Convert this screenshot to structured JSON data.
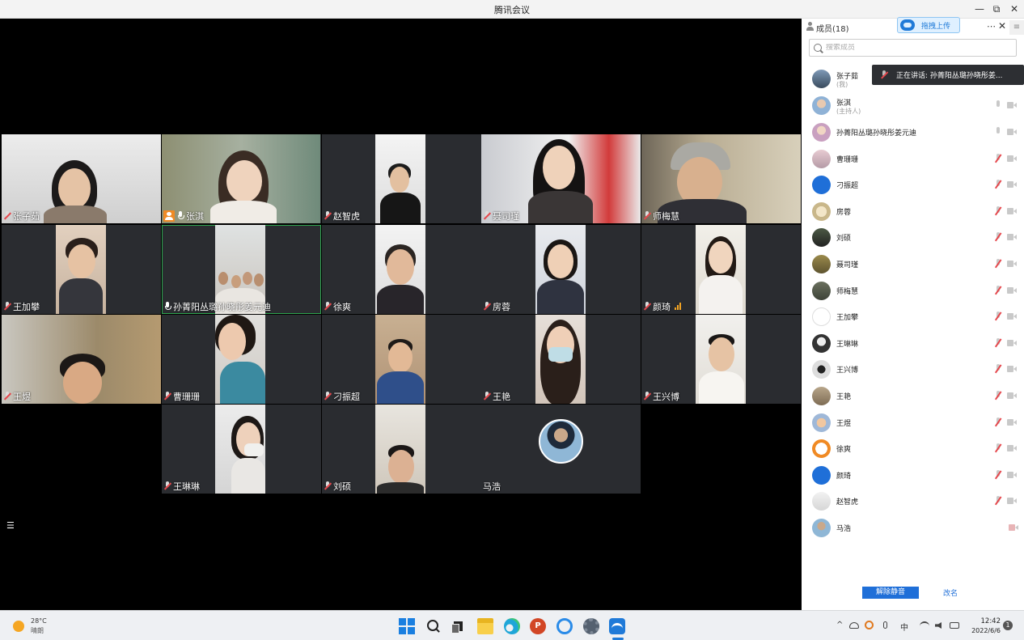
{
  "window": {
    "title": "腾讯会议",
    "minimize_label": "—",
    "restore_label": "⧉",
    "close_label": "✕"
  },
  "tiles": [
    {
      "name": "张子茹"
    },
    {
      "name": "张淇"
    },
    {
      "name": "赵智虎"
    },
    {
      "name": "聂司瑾"
    },
    {
      "name": "师梅慧"
    },
    {
      "name": "王加攀"
    },
    {
      "name": "孙菁阳丛璐孙晓彤姜元迪"
    },
    {
      "name": "徐爽"
    },
    {
      "name": "房蓉"
    },
    {
      "name": "颜琦"
    },
    {
      "name": "王煜"
    },
    {
      "name": "曹珊珊"
    },
    {
      "name": "刁振超"
    },
    {
      "name": "王艳"
    },
    {
      "name": "王兴博"
    },
    {
      "name": "王琳琳"
    },
    {
      "name": "刘硕"
    },
    {
      "name": "马浩"
    }
  ],
  "video_area": {
    "list_icon": "☰"
  },
  "sidebar": {
    "title": "成员(18)",
    "upload_label": "拖拽上传",
    "more_label": "⋯",
    "close_label": "✕",
    "menu_label": "≡",
    "search_placeholder": "搜索成员",
    "speaking_text": "正在讲话: 孙菁阳丛璐孙晓彤姜...",
    "members": [
      {
        "name": "张子茹",
        "role": "(我)"
      },
      {
        "name": "张淇",
        "role": "(主持人)"
      },
      {
        "name": "孙菁阳丛璐孙晓彤姜元迪",
        "role": ""
      },
      {
        "name": "曹珊珊",
        "role": ""
      },
      {
        "name": "刁振超",
        "role": ""
      },
      {
        "name": "房蓉",
        "role": ""
      },
      {
        "name": "刘硕",
        "role": ""
      },
      {
        "name": "聂司瑾",
        "role": ""
      },
      {
        "name": "师梅慧",
        "role": ""
      },
      {
        "name": "王加攀",
        "role": ""
      },
      {
        "name": "王琳琳",
        "role": ""
      },
      {
        "name": "王兴博",
        "role": ""
      },
      {
        "name": "王艳",
        "role": ""
      },
      {
        "name": "王煜",
        "role": ""
      },
      {
        "name": "徐爽",
        "role": ""
      },
      {
        "name": "颜琦",
        "role": ""
      },
      {
        "name": "赵智虎",
        "role": ""
      },
      {
        "name": "马浩",
        "role": ""
      }
    ],
    "unmute_all_label": "解除静音",
    "rename_label": "改名"
  },
  "taskbar": {
    "weather_temp": "28°C",
    "weather_desc": "晴朗",
    "ppt_letter": "P",
    "tray": {
      "chevron": "^",
      "ime": "中"
    },
    "clock_time": "12:42",
    "clock_date": "2022/6/6",
    "notification_count": "1"
  }
}
